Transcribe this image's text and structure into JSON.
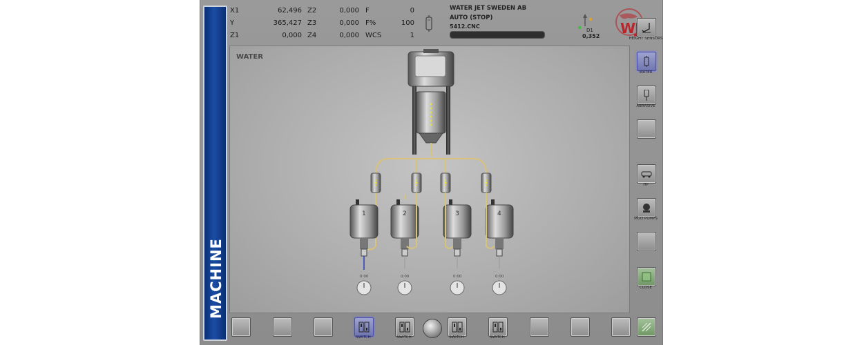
{
  "coordinates": [
    {
      "axis": "X1",
      "value": "62,496"
    },
    {
      "axis": "Y",
      "value": "365,427"
    },
    {
      "axis": "Z1",
      "value": "0,000"
    }
  ],
  "coordinates2": [
    {
      "axis": "Z2",
      "value": "0,000"
    },
    {
      "axis": "Z3",
      "value": "0,000"
    },
    {
      "axis": "Z4",
      "value": "0,000"
    }
  ],
  "coordinates3": [
    {
      "axis": "F",
      "value": "0"
    },
    {
      "axis": "F%",
      "value": "100"
    },
    {
      "axis": "WCS",
      "value": "1"
    }
  ],
  "status": {
    "company": "WATER JET SWEDEN AB",
    "mode": "AUTO (STOP)",
    "program": "5412.CNC",
    "progress": 0.0
  },
  "d1": {
    "label": "D1",
    "value": "0,352"
  },
  "logo": {
    "text": "WJS"
  },
  "sidebar": {
    "label": "MACHINE"
  },
  "panel": {
    "title": "WATER",
    "heads": [
      {
        "number": "1",
        "time": "0:00",
        "active": true
      },
      {
        "number": "2",
        "time": "0:00",
        "active": false
      },
      {
        "number": "3",
        "time": "0:00",
        "active": false
      },
      {
        "number": "4",
        "time": "0:00",
        "active": false
      }
    ]
  },
  "right_buttons": [
    {
      "label": "HEIGHT SENSORS",
      "icon": "height-sensor-icon"
    },
    {
      "label": "WATER",
      "icon": "water-icon",
      "active": true
    },
    {
      "label": "ABRASIVE",
      "icon": "abrasive-icon"
    },
    {
      "label": "",
      "icon": ""
    },
    {
      "label": "HP",
      "icon": "hp-pump-icon"
    },
    {
      "label": "MUD PUMPS",
      "icon": "mud-pump-icon"
    },
    {
      "label": "",
      "icon": ""
    },
    {
      "label": "CLOSE",
      "icon": "close-icon"
    }
  ],
  "bottom_buttons": [
    {
      "label": ""
    },
    {
      "label": ""
    },
    {
      "label": ""
    },
    {
      "label": "SWITCH",
      "active": true
    },
    {
      "label": "SWITCH"
    },
    {
      "label": "SWITCH"
    },
    {
      "label": "SWITCH"
    },
    {
      "label": ""
    },
    {
      "label": ""
    },
    {
      "label": ""
    }
  ],
  "colors": {
    "band": "#0a2f72",
    "active_button": "#6f76b0",
    "pipe": "#d9c27a",
    "jet": "#2b3fbf",
    "logo": "#b8262c"
  }
}
